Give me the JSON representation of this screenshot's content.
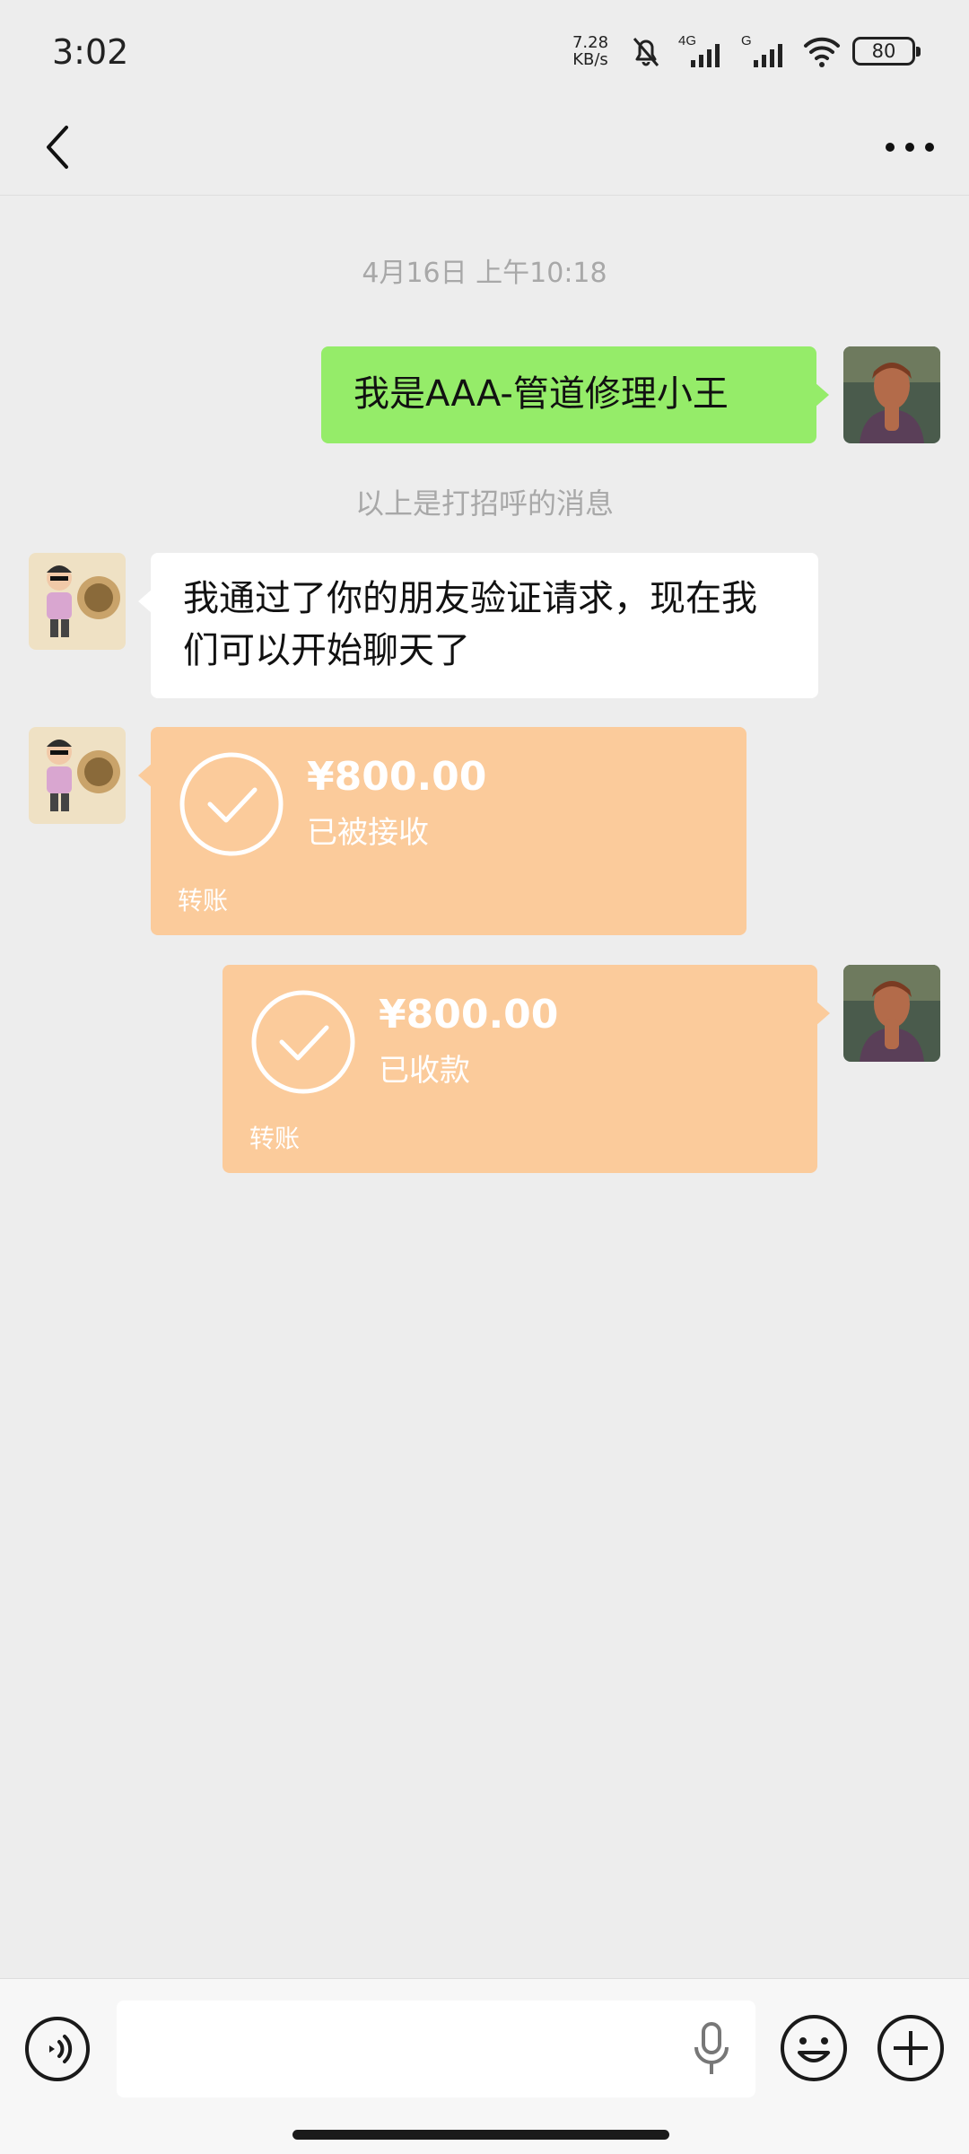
{
  "status_bar": {
    "time": "3:02",
    "net_speed": "7.28",
    "net_speed_unit": "KB/s",
    "net_label_1": "4G",
    "net_label_2": "G",
    "battery": "80"
  },
  "header": {
    "title": "",
    "icons": {
      "back": "chevron-left-icon",
      "more": "more-dots-icon"
    }
  },
  "chat": {
    "timestamp": "4月16日 上午10:18",
    "greeting_text": "我是AAA-管道修理小王",
    "system_notice": "以上是打招呼的消息",
    "received_text": "我通过了你的朋友验证请求，现在我们可以开始聊天了",
    "transfer_received": {
      "amount": "¥800.00",
      "status": "已被接收",
      "label": "转账"
    },
    "transfer_sent": {
      "amount": "¥800.00",
      "status": "已收款",
      "label": "转账"
    }
  },
  "input_bar": {
    "placeholder": "",
    "icons": [
      "voice-icon",
      "microphone-icon",
      "emoji-icon",
      "plus-icon"
    ]
  },
  "colors": {
    "background": "#ededed",
    "sent_bubble": "#95ec69",
    "received_bubble": "#ffffff",
    "transfer_card": "#fbcb9b",
    "meta_text": "#a8a8a8"
  }
}
